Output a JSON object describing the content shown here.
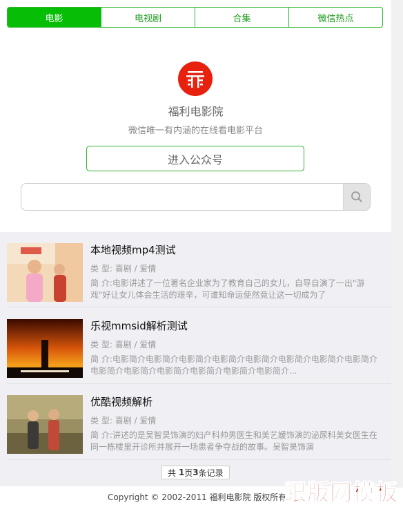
{
  "nav": {
    "tabs": [
      {
        "label": "电影",
        "active": true
      },
      {
        "label": "电视剧"
      },
      {
        "label": "合集"
      },
      {
        "label": "微信热点"
      }
    ]
  },
  "profile": {
    "name": "福利电影院",
    "tagline": "微信唯一有内涵的在线看电影平台",
    "follow_label": "进入公众号",
    "logo_icon": "cinema-logo-icon"
  },
  "search": {
    "placeholder": "",
    "button_icon": "search-icon"
  },
  "movies": [
    {
      "title": "本地视频mp4测试",
      "type_label": "类 型:",
      "type_value": "喜剧 / 爱情",
      "desc_label": "简 介:",
      "desc": "电影讲述了一位著名企业家为了教育自己的女儿，自导自演了一出\"游戏\"好让女儿体会生活的艰辛，可谁知命运使然竟让这一切成为了"
    },
    {
      "title": "乐视mmsid解析测试",
      "type_label": "类 型:",
      "type_value": "喜剧 / 爱情",
      "desc_label": "简 介:",
      "desc": "电影简介电影简介电影简介电影简介电影简介电影简介电影简介电影简介电影简介电影简介电影简介电影简介电影简介电影简介..."
    },
    {
      "title": "优酷视频解析",
      "type_label": "类 型:",
      "type_value": "喜剧 / 爱情",
      "desc_label": "简 介:",
      "desc": "讲述的是吴智昊饰演的妇产科帅男医生和美艺媛饰演的泌尿科美女医生在同一栋楼里开诊所并展开一场患者争夺战的故事。吴智昊饰演"
    }
  ],
  "pager": {
    "prefix": "共",
    "pages": "1",
    "mid": "页",
    "records": "3",
    "suffix": "条记录"
  },
  "footer": {
    "copyright": "Copyright © 2002-2011 福利电影院 版权所有"
  },
  "watermark": "跟版网模板",
  "colors": {
    "accent": "#06be06",
    "logo": "#e8200e",
    "list_bg": "#f0eff4"
  }
}
